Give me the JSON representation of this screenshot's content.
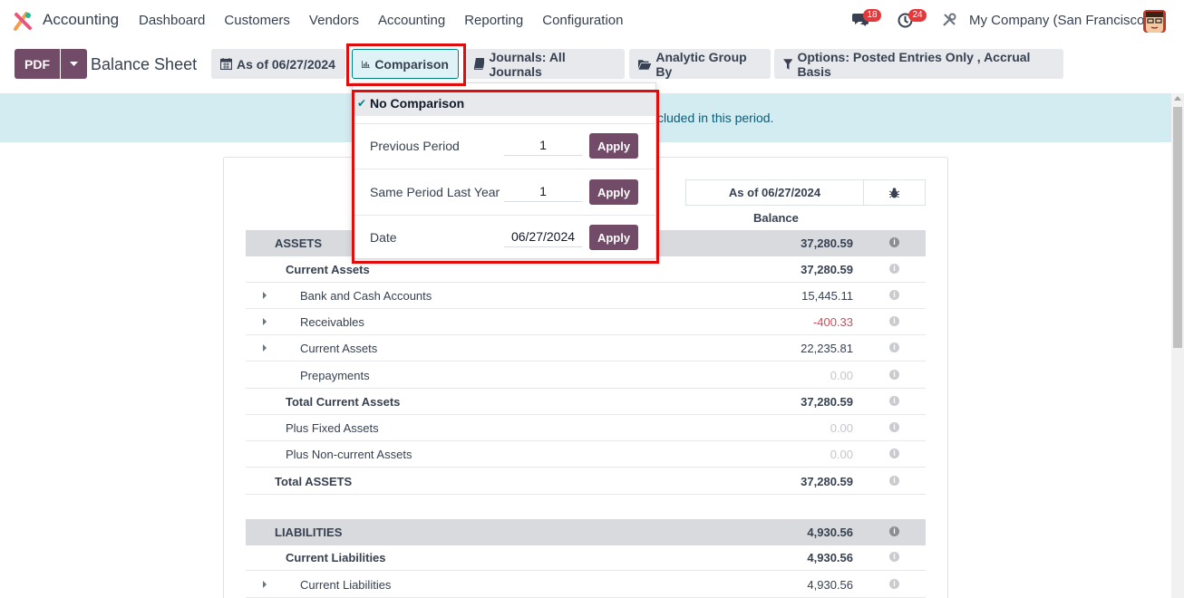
{
  "navbar": {
    "app_name": "Accounting",
    "menu": [
      "Dashboard",
      "Customers",
      "Vendors",
      "Accounting",
      "Reporting",
      "Configuration"
    ],
    "messages_count": "18",
    "activities_count": "24",
    "company": "My Company (San Francisco)"
  },
  "control": {
    "pdf_label": "PDF",
    "page_title": "Balance Sheet",
    "filters": {
      "date": "As of 06/27/2024",
      "comparison": "Comparison",
      "journals": "Journals: All Journals",
      "analytic": "Analytic Group By",
      "options": "Options: Posted Entries Only , Accrual Basis"
    }
  },
  "banner": {
    "text": "cluded in this period."
  },
  "comparison_dropdown": {
    "selected": "No Comparison",
    "previous_period": {
      "label": "Previous Period",
      "value": "1",
      "apply": "Apply"
    },
    "same_period": {
      "label": "Same Period Last Year",
      "value": "1",
      "apply": "Apply"
    },
    "date": {
      "label": "Date",
      "value": "06/27/2024",
      "apply": "Apply"
    }
  },
  "report": {
    "column_header": "As of 06/27/2024",
    "balance_label": "Balance",
    "rows": [
      {
        "label": "ASSETS",
        "amount": "37,280.59"
      },
      {
        "label": "Current Assets",
        "amount": "37,280.59"
      },
      {
        "label": "Bank and Cash Accounts",
        "amount": "15,445.11"
      },
      {
        "label": "Receivables",
        "amount": "-400.33"
      },
      {
        "label": "Current Assets",
        "amount": "22,235.81"
      },
      {
        "label": "Prepayments",
        "amount": "0.00"
      },
      {
        "label": "Total Current Assets",
        "amount": "37,280.59"
      },
      {
        "label": "Plus Fixed Assets",
        "amount": "0.00"
      },
      {
        "label": "Plus Non-current Assets",
        "amount": "0.00"
      },
      {
        "label": "Total ASSETS",
        "amount": "37,280.59"
      },
      {
        "label": "LIABILITIES",
        "amount": "4,930.56"
      },
      {
        "label": "Current Liabilities",
        "amount": "4,930.56"
      },
      {
        "label": "Current Liabilities",
        "amount": "4,930.56"
      }
    ]
  },
  "colors": {
    "brand": "#714b67",
    "highlight": "#e10d0d",
    "banner_bg": "#d2ecf1",
    "negative": "#d44c59"
  }
}
